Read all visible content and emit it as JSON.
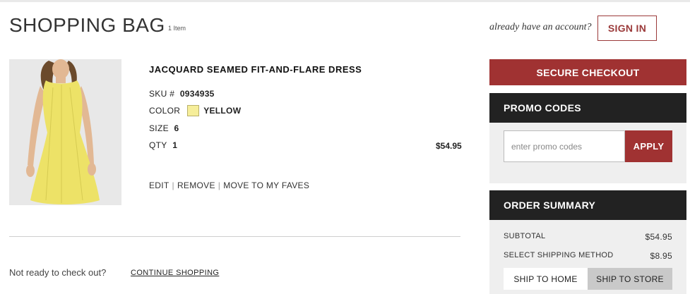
{
  "header": {
    "title": "SHOPPING BAG",
    "item_count": "1 Item",
    "account_prompt": "already have an account?",
    "sign_in_label": "SIGN IN"
  },
  "item": {
    "name": "JACQUARD SEAMED FIT-AND-FLARE DRESS",
    "sku_label": "SKU #",
    "sku": "0934935",
    "color_label": "COLOR",
    "color": "YELLOW",
    "color_swatch": "#f6ee9a",
    "size_label": "SIZE",
    "size": "6",
    "qty_label": "QTY",
    "qty": "1",
    "price": "$54.95",
    "actions": {
      "edit": "EDIT",
      "remove": "REMOVE",
      "move_to_faves": "MOVE TO MY FAVES"
    }
  },
  "footer": {
    "not_ready": "Not ready to check out?",
    "continue_shopping": "CONTINUE SHOPPING"
  },
  "sidebar": {
    "checkout_label": "SECURE CHECKOUT",
    "promo": {
      "title": "PROMO CODES",
      "placeholder": "enter promo codes",
      "apply_label": "APPLY"
    },
    "summary": {
      "title": "ORDER SUMMARY",
      "subtotal_label": "SUBTOTAL",
      "subtotal": "$54.95",
      "shipping_label": "SELECT SHIPPING METHOD",
      "shipping": "$8.95",
      "tabs": [
        "SHIP TO HOME",
        "SHIP TO STORE"
      ]
    }
  },
  "colors": {
    "accent": "#a03232",
    "panel_dark": "#222222",
    "panel_light": "#efefef"
  }
}
